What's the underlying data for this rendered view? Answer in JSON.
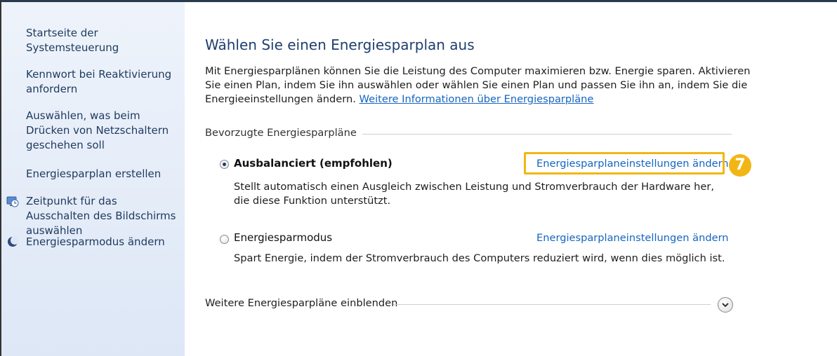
{
  "sidebar": {
    "items": [
      {
        "label": "Startseite der Systemsteuerung"
      },
      {
        "label": "Kennwort bei Reaktivierung anfordern"
      },
      {
        "label": "Auswählen, was beim Drücken von Netzschaltern geschehen soll"
      },
      {
        "label": "Energiesparplan erstellen"
      },
      {
        "label": "Zeitpunkt für das Ausschalten des Bildschirms auswählen",
        "icon": "display-clock-icon"
      },
      {
        "label": "Energiesparmodus ändern",
        "icon": "moon-icon"
      }
    ]
  },
  "main": {
    "title": "Wählen Sie einen Energiesparplan aus",
    "description": "Mit Energiesparplänen können Sie die Leistung des Computer maximieren bzw. Energie sparen. Aktivieren Sie einen Plan, indem Sie ihn auswählen oder wählen Sie einen Plan und passen Sie ihn an, indem Sie die Energieeinstellungen ändern.",
    "more_info_link": "Weitere Informationen über Energiesparpläne",
    "group_label": "Bevorzugte Energiesparpläne",
    "plans": [
      {
        "name": "Ausbalanciert (empfohlen)",
        "selected": true,
        "description": "Stellt automatisch einen Ausgleich zwischen Leistung und Stromverbrauch der Hardware her, die diese Funktion unterstützt.",
        "settings_link": "Energiesparplaneinstellungen ändern"
      },
      {
        "name": "Energiesparmodus",
        "selected": false,
        "description": "Spart Energie, indem der Stromverbrauch des Computers reduziert wird, wenn dies möglich ist.",
        "settings_link": "Energiesparplaneinstellungen ändern"
      }
    ],
    "more_plans_label": "Weitere Energiesparpläne einblenden"
  },
  "annotation": {
    "step_number": "7",
    "color": "#f2b614"
  },
  "colors": {
    "link": "#1565c0",
    "title": "#1e3f6e",
    "sidebar_text": "#1e3a5e"
  }
}
